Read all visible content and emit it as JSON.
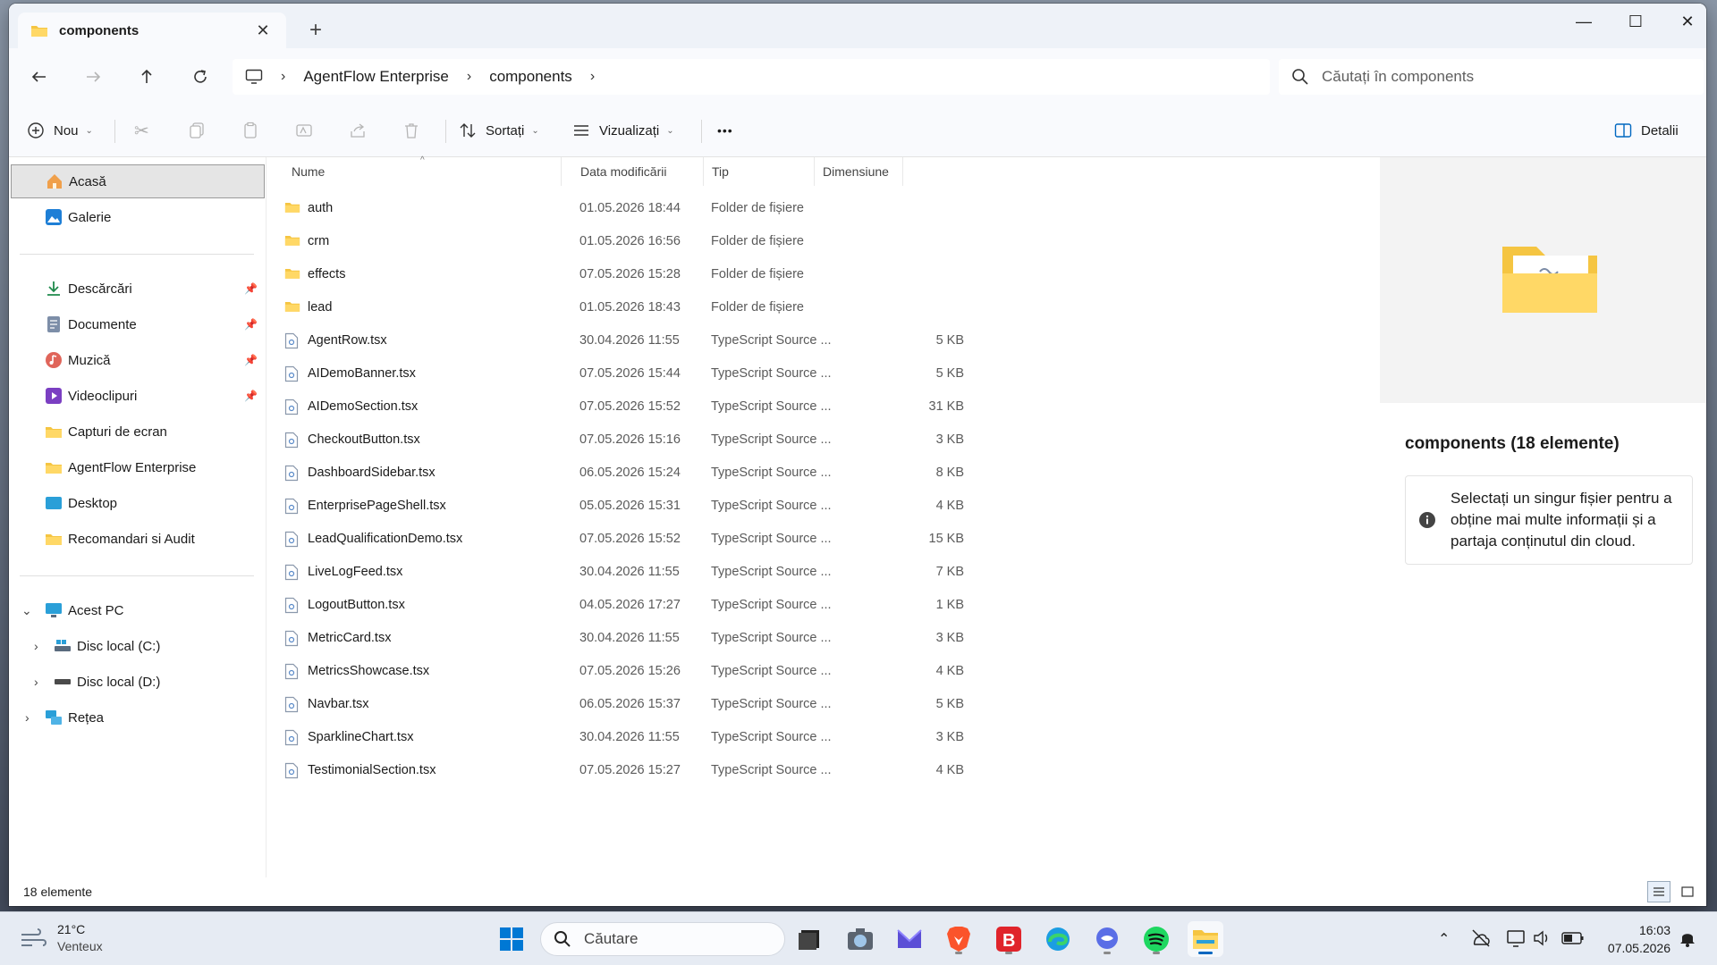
{
  "window": {
    "tab_title": "components",
    "new_tab": "+",
    "controls": {
      "minimize": "—",
      "maximize": "☐",
      "close": "✕"
    }
  },
  "address": {
    "segments": [
      "AgentFlow Enterprise",
      "components"
    ],
    "search_placeholder": "Căutați în components"
  },
  "toolbar": {
    "new_label": "Nou",
    "sort_label": "Sortați",
    "view_label": "Vizualizați",
    "more_label": "•••",
    "details_label": "Detalii"
  },
  "sidebar": {
    "home": "Acasă",
    "gallery": "Galerie",
    "quick": [
      {
        "label": "Descărcări",
        "icon": "download-icon",
        "pinned": true
      },
      {
        "label": "Documente",
        "icon": "documents-icon",
        "pinned": true
      },
      {
        "label": "Muzică",
        "icon": "music-icon",
        "pinned": true
      },
      {
        "label": "Videoclipuri",
        "icon": "videos-icon",
        "pinned": true
      },
      {
        "label": "Capturi de ecran",
        "icon": "folder-icon",
        "pinned": false
      },
      {
        "label": "AgentFlow Enterprise",
        "icon": "folder-icon",
        "pinned": false
      },
      {
        "label": "Desktop",
        "icon": "desktop-icon",
        "pinned": false
      },
      {
        "label": "Recomandari si Audit",
        "icon": "folder-icon",
        "pinned": false
      }
    ],
    "this_pc": "Acest PC",
    "drive_c": "Disc local (C:)",
    "drive_d": "Disc local (D:)",
    "network": "Rețea"
  },
  "columns": {
    "name": "Nume",
    "date": "Data modificării",
    "type": "Tip",
    "size": "Dimensiune"
  },
  "files": [
    {
      "name": "auth",
      "date": "01.05.2026 18:44",
      "type": "Folder de fișiere",
      "size": "",
      "kind": "folder"
    },
    {
      "name": "crm",
      "date": "01.05.2026 16:56",
      "type": "Folder de fișiere",
      "size": "",
      "kind": "folder"
    },
    {
      "name": "effects",
      "date": "07.05.2026 15:28",
      "type": "Folder de fișiere",
      "size": "",
      "kind": "folder"
    },
    {
      "name": "lead",
      "date": "01.05.2026 18:43",
      "type": "Folder de fișiere",
      "size": "",
      "kind": "folder"
    },
    {
      "name": "AgentRow.tsx",
      "date": "30.04.2026 11:55",
      "type": "TypeScript Source ...",
      "size": "5 KB",
      "kind": "file"
    },
    {
      "name": "AIDemoBanner.tsx",
      "date": "07.05.2026 15:44",
      "type": "TypeScript Source ...",
      "size": "5 KB",
      "kind": "file"
    },
    {
      "name": "AIDemoSection.tsx",
      "date": "07.05.2026 15:52",
      "type": "TypeScript Source ...",
      "size": "31 KB",
      "kind": "file"
    },
    {
      "name": "CheckoutButton.tsx",
      "date": "07.05.2026 15:16",
      "type": "TypeScript Source ...",
      "size": "3 KB",
      "kind": "file"
    },
    {
      "name": "DashboardSidebar.tsx",
      "date": "06.05.2026 15:24",
      "type": "TypeScript Source ...",
      "size": "8 KB",
      "kind": "file"
    },
    {
      "name": "EnterprisePageShell.tsx",
      "date": "05.05.2026 15:31",
      "type": "TypeScript Source ...",
      "size": "4 KB",
      "kind": "file"
    },
    {
      "name": "LeadQualificationDemo.tsx",
      "date": "07.05.2026 15:52",
      "type": "TypeScript Source ...",
      "size": "15 KB",
      "kind": "file"
    },
    {
      "name": "LiveLogFeed.tsx",
      "date": "30.04.2026 11:55",
      "type": "TypeScript Source ...",
      "size": "7 KB",
      "kind": "file"
    },
    {
      "name": "LogoutButton.tsx",
      "date": "04.05.2026 17:27",
      "type": "TypeScript Source ...",
      "size": "1 KB",
      "kind": "file"
    },
    {
      "name": "MetricCard.tsx",
      "date": "30.04.2026 11:55",
      "type": "TypeScript Source ...",
      "size": "3 KB",
      "kind": "file"
    },
    {
      "name": "MetricsShowcase.tsx",
      "date": "07.05.2026 15:26",
      "type": "TypeScript Source ...",
      "size": "4 KB",
      "kind": "file"
    },
    {
      "name": "Navbar.tsx",
      "date": "06.05.2026 15:37",
      "type": "TypeScript Source ...",
      "size": "5 KB",
      "kind": "file"
    },
    {
      "name": "SparklineChart.tsx",
      "date": "30.04.2026 11:55",
      "type": "TypeScript Source ...",
      "size": "3 KB",
      "kind": "file"
    },
    {
      "name": "TestimonialSection.tsx",
      "date": "07.05.2026 15:27",
      "type": "TypeScript Source ...",
      "size": "4 KB",
      "kind": "file"
    }
  ],
  "details": {
    "title": "components (18 elemente)",
    "info": "Selectați un singur fișier pentru a obține mai multe informații și a partaja conținutul din cloud."
  },
  "status": {
    "count": "18 elemente"
  },
  "taskbar": {
    "weather_temp": "21°C",
    "weather_desc": "Venteux",
    "search_placeholder": "Căutare",
    "time": "16:03",
    "date": "07.05.2026"
  },
  "colors": {
    "folder": "#f5c542",
    "accent": "#0067c0",
    "win_blue": "#0078d4"
  }
}
